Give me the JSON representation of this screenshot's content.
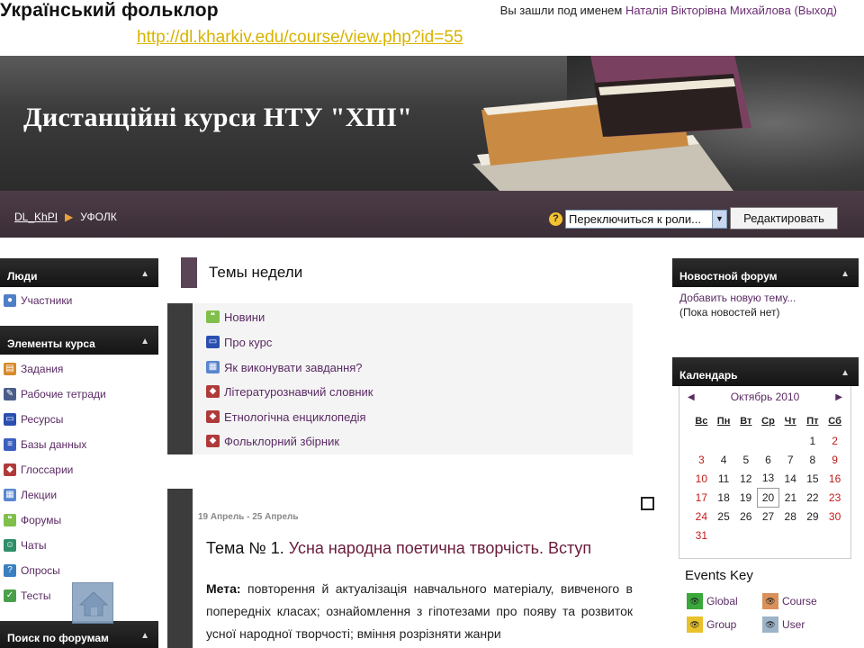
{
  "header": {
    "course_title": "Український фольклор",
    "login_prefix": "Вы зашли под именем ",
    "user_name": "Наталія Вікторівна Михайлова",
    "logout": "(Выход)",
    "url": "http://dl.kharkiv.edu/course/view.php?id=55"
  },
  "banner": {
    "title": "Дистанційні курси НТУ \"ХПІ\""
  },
  "nav": {
    "crumb_root": "DL_KhPI",
    "crumb_current": "УФОЛК",
    "help": "?",
    "role_select": "Переключиться к роли...",
    "edit_button": "Редактировать"
  },
  "left": {
    "people": {
      "title": "Люди",
      "items": [
        {
          "label": "Участники",
          "icon": "participants-icon"
        }
      ]
    },
    "activities": {
      "title": "Элементы курса",
      "items": [
        {
          "label": "Задания",
          "icon": "assignment-icon"
        },
        {
          "label": "Рабочие тетради",
          "icon": "journal-icon"
        },
        {
          "label": "Ресурсы",
          "icon": "resource-icon"
        },
        {
          "label": "Базы данных",
          "icon": "database-icon"
        },
        {
          "label": "Глоссарии",
          "icon": "glossary-icon"
        },
        {
          "label": "Лекции",
          "icon": "lesson-icon"
        },
        {
          "label": "Форумы",
          "icon": "forum-icon"
        },
        {
          "label": "Чаты",
          "icon": "chat-icon"
        },
        {
          "label": "Опросы",
          "icon": "choice-icon"
        },
        {
          "label": "Тесты",
          "icon": "quiz-icon"
        }
      ]
    },
    "search": {
      "title": "Поиск по форумам"
    }
  },
  "center": {
    "title": "Темы недели",
    "section0": [
      {
        "label": "Новини",
        "icon": "forum-icon"
      },
      {
        "label": "Про курс",
        "icon": "page-icon"
      },
      {
        "label": "Як виконувати завдання?",
        "icon": "lesson-icon"
      },
      {
        "label": "Літературознавчий словник",
        "icon": "glossary-icon"
      },
      {
        "label": "Етнологічна енциклопедія",
        "icon": "glossary-icon"
      },
      {
        "label": "Фольклорний збірник",
        "icon": "glossary-icon"
      }
    ],
    "week": {
      "dates": "19 Апрель - 25 Апрель",
      "topic_prefix": "Тема № 1.",
      "topic_link": "Усна народна поетична творчість. Вступ",
      "goal_label": "Мета:",
      "goal_text": "повторення й актуалізація навчального матеріалу, вивченого в попередніх класах; ознайомлення з гіпотезами про появу та розвиток усної народної творчості; вміння розрізняти жанри"
    }
  },
  "right": {
    "news": {
      "title": "Новостной форум",
      "add_link": "Добавить новую тему...",
      "empty": "(Пока новостей нет)"
    },
    "calendar": {
      "title": "Календарь",
      "month": "Октябрь 2010",
      "weekdays": [
        "Вс",
        "Пн",
        "Вт",
        "Ср",
        "Чт",
        "Пт",
        "Сб"
      ],
      "weeks": [
        [
          "",
          "",
          "",
          "",
          "",
          "1",
          "2"
        ],
        [
          "3",
          "4",
          "5",
          "6",
          "7",
          "8",
          "9"
        ],
        [
          "10",
          "11",
          "12",
          "13",
          "14",
          "15",
          "16"
        ],
        [
          "17",
          "18",
          "19",
          "20",
          "21",
          "22",
          "23"
        ],
        [
          "24",
          "25",
          "26",
          "27",
          "28",
          "29",
          "30"
        ],
        [
          "31",
          "",
          "",
          "",
          "",
          "",
          ""
        ]
      ],
      "today": "20"
    },
    "events_key": {
      "title": "Events Key",
      "items": [
        {
          "label": "Global",
          "color": "#3aa83a"
        },
        {
          "label": "Course",
          "color": "#d9905a"
        },
        {
          "label": "Group",
          "color": "#e8c12c"
        },
        {
          "label": "User",
          "color": "#9db3c8"
        }
      ]
    }
  },
  "colors": {
    "accent": "#5a2a63",
    "header_dark": "#1e1e1e",
    "weekend": "#c21b1b"
  }
}
